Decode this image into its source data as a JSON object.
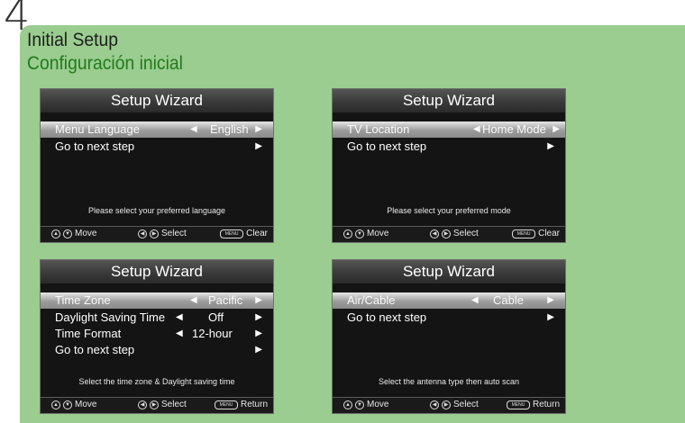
{
  "page": {
    "step_number": "4",
    "title_en": "Initial Setup",
    "title_es": "Configuración inicial"
  },
  "icons": {
    "left_arrow": "◀",
    "right_arrow": "▶",
    "up": "▲",
    "down": "▼",
    "left": "◀",
    "right": "▶",
    "menu_key": "MENU"
  },
  "screens": [
    {
      "header": "Setup Wizard",
      "rows": [
        {
          "label": "Menu Language",
          "value": "English",
          "selected": true
        },
        {
          "label": "Go to next step",
          "value": "",
          "selected": false
        }
      ],
      "hint": "Please select your preferred language",
      "footer": {
        "move": "Move",
        "select": "Select",
        "action": "Clear"
      }
    },
    {
      "header": "Setup Wizard",
      "rows": [
        {
          "label": "TV Location",
          "value": "Home Mode",
          "selected": true
        },
        {
          "label": "Go to next step",
          "value": "",
          "selected": false
        }
      ],
      "hint": "Please select your preferred mode",
      "footer": {
        "move": "Move",
        "select": "Select",
        "action": "Clear"
      }
    },
    {
      "header": "Setup Wizard",
      "rows": [
        {
          "label": "Time Zone",
          "value": "Pacific",
          "selected": true
        },
        {
          "label": "Daylight Saving Time",
          "value": "Off",
          "selected": false
        },
        {
          "label": "Time Format",
          "value": "12-hour",
          "selected": false
        },
        {
          "label": "Go to next step",
          "value": "",
          "selected": false
        }
      ],
      "hint": "Select the time zone & Daylight saving time",
      "footer": {
        "move": "Move",
        "select": "Select",
        "action": "Return"
      }
    },
    {
      "header": "Setup Wizard",
      "rows": [
        {
          "label": "Air/Cable",
          "value": "Cable",
          "selected": true
        },
        {
          "label": "Go to next step",
          "value": "",
          "selected": false
        }
      ],
      "hint": "Select the antenna type then auto scan",
      "footer": {
        "move": "Move",
        "select": "Select",
        "action": "Return"
      }
    }
  ]
}
